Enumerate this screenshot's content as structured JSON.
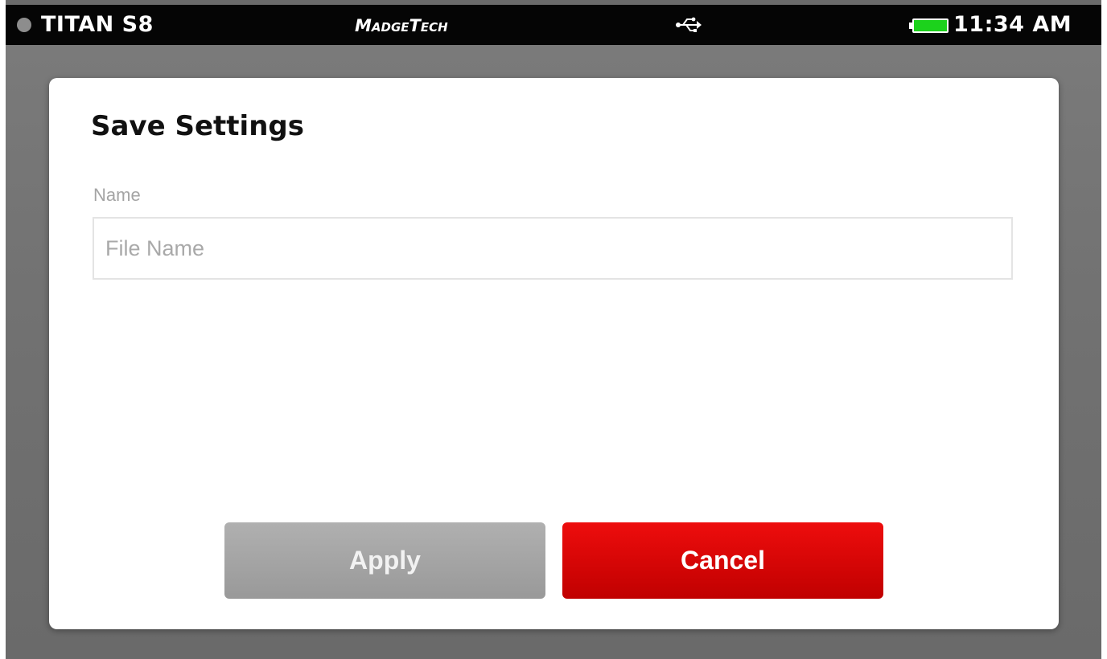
{
  "status_bar": {
    "device_name": "TITAN S8",
    "brand": "MadgeTech",
    "usb_icon": "usb-icon",
    "battery_icon": "battery-icon",
    "battery_color": "#1cd21c",
    "time": "11:34 AM"
  },
  "dialog": {
    "title": "Save Settings",
    "name_label": "Name",
    "name_input": {
      "value": "",
      "placeholder": "File Name"
    },
    "apply_label": "Apply",
    "cancel_label": "Cancel"
  },
  "colors": {
    "cancel_button": "#d60000",
    "apply_button": "#a6a6a6",
    "status_bar": "#050505"
  }
}
